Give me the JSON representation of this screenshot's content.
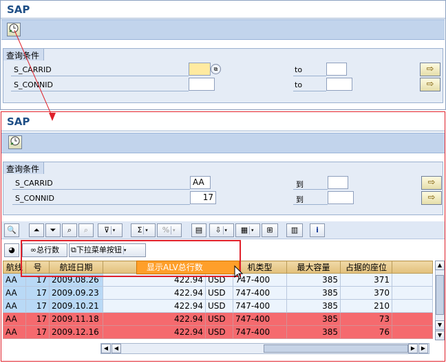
{
  "top_window": {
    "title": "SAP",
    "selection": {
      "group_title": "查询条件",
      "rows": [
        {
          "label": "S_CARRID",
          "to_label": "to",
          "value": "",
          "to_value": ""
        },
        {
          "label": "S_CONNID",
          "to_label": "to",
          "value": "",
          "to_value": ""
        }
      ]
    }
  },
  "bottom_window": {
    "title": "SAP",
    "selection": {
      "group_title": "查询条件",
      "rows": [
        {
          "label": "S_CARRID",
          "to_label": "到",
          "value": "AA",
          "to_value": ""
        },
        {
          "label": "S_CONNID",
          "to_label": "到",
          "value": "17",
          "to_value": ""
        }
      ]
    },
    "custom_toolbar": {
      "total_rows_button": "总行数",
      "dropdown_button": "下拉菜单按钮"
    },
    "context_menu": {
      "item_label": "显示ALV总行数",
      "item_hotkey": "A"
    },
    "table": {
      "columns": [
        "航线",
        "号",
        "航班日期",
        "",
        "",
        "机类型",
        "最大容量",
        "占据的座位"
      ],
      "rows": [
        {
          "carrier": "AA",
          "conn": "17",
          "date": "2009.08.26",
          "price": "422.94",
          "currency": "USD",
          "plane": "747-400",
          "max": "385",
          "occ": "371",
          "style": "blue"
        },
        {
          "carrier": "AA",
          "conn": "17",
          "date": "2009.09.23",
          "price": "422.94",
          "currency": "USD",
          "plane": "747-400",
          "max": "385",
          "occ": "370",
          "style": "blue"
        },
        {
          "carrier": "AA",
          "conn": "17",
          "date": "2009.10.21",
          "price": "422.94",
          "currency": "USD",
          "plane": "747-400",
          "max": "385",
          "occ": "210",
          "style": "blue"
        },
        {
          "carrier": "AA",
          "conn": "17",
          "date": "2009.11.18",
          "price": "422.94",
          "currency": "USD",
          "plane": "747-400",
          "max": "385",
          "occ": "73",
          "style": "red"
        },
        {
          "carrier": "AA",
          "conn": "17",
          "date": "2009.12.16",
          "price": "422.94",
          "currency": "USD",
          "plane": "747-400",
          "max": "385",
          "occ": "76",
          "style": "red"
        }
      ]
    }
  },
  "colors": {
    "highlight_box": "#e0202a",
    "menu_orange": "#ff9f2a",
    "row_red": "#f56a6e",
    "row_blue": "#ecf4fd"
  }
}
